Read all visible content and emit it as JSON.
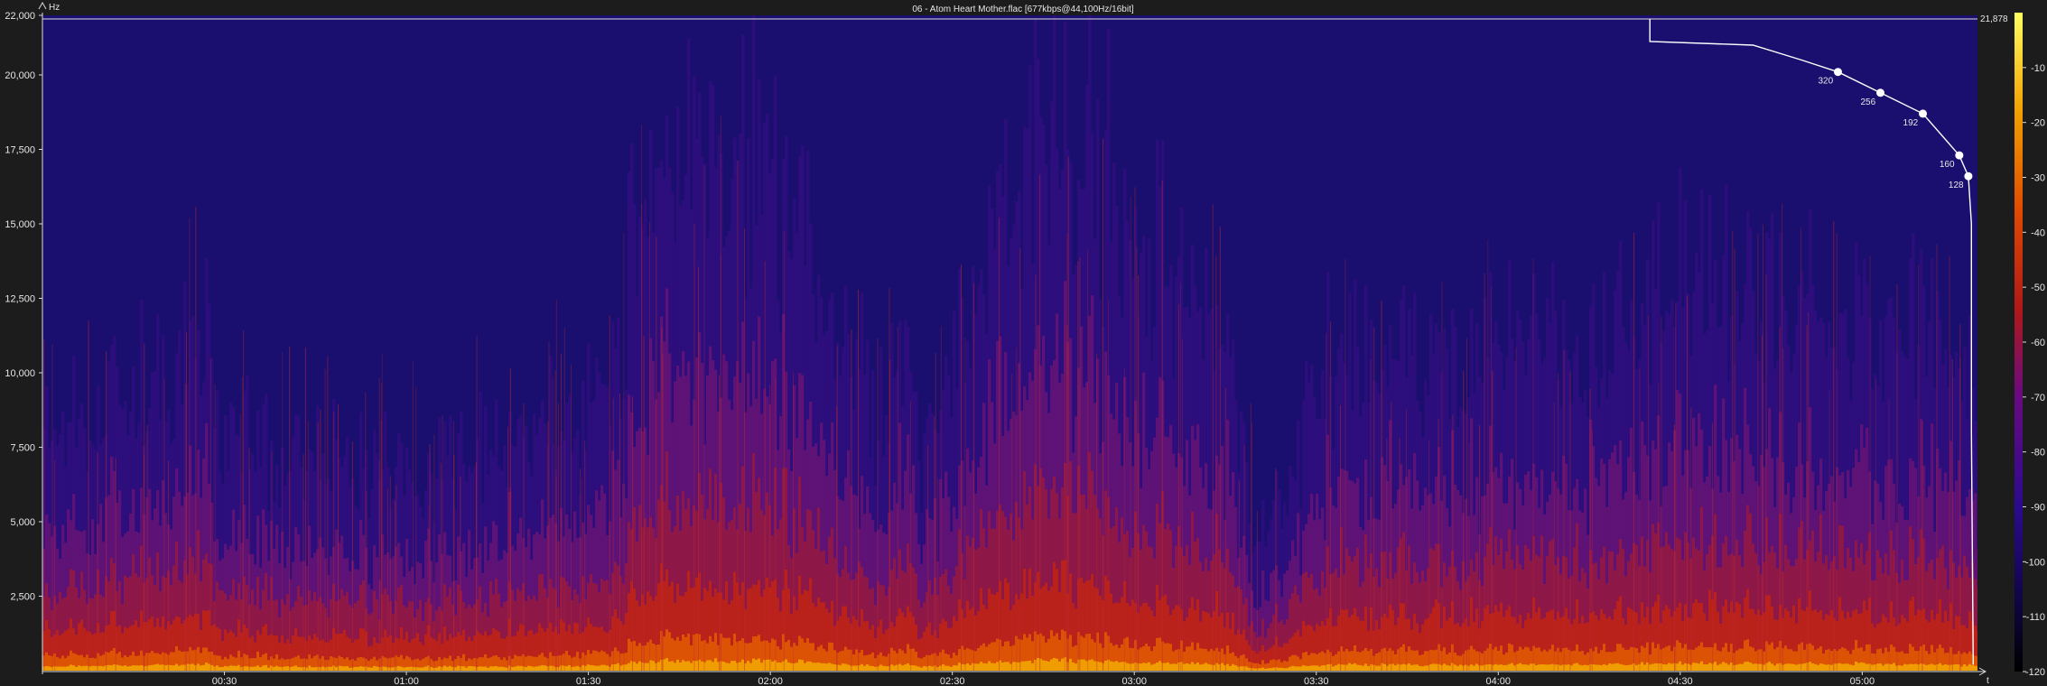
{
  "window": {
    "title": "06 - Atom Heart Mother.flac [677kbps@44,100Hz/16bit]"
  },
  "chart_data": {
    "type": "heatmap",
    "title": "06 - Atom Heart Mother.flac [677kbps@44,100Hz/16bit]",
    "ylabel": "Hz",
    "xlabel": "t",
    "x_range_seconds": [
      0,
      319
    ],
    "ylim": [
      0,
      22000
    ],
    "y_ticks": [
      2500,
      5000,
      7500,
      10000,
      12500,
      15000,
      17500,
      20000,
      22000
    ],
    "y_tick_labels": [
      "2,500",
      "5,000",
      "7,500",
      "10,000",
      "12,500",
      "15,000",
      "17,500",
      "20,000",
      "22,000"
    ],
    "x_ticks": [
      30,
      60,
      90,
      120,
      150,
      180,
      210,
      240,
      270,
      300
    ],
    "x_tick_labels": [
      "00:30",
      "01:00",
      "01:30",
      "02:00",
      "02:30",
      "03:00",
      "03:30",
      "04:00",
      "04:30",
      "05:00"
    ],
    "colorbar": {
      "range_db": [
        -120,
        0
      ],
      "ticks": [
        -10,
        -20,
        -30,
        -40,
        -50,
        -60,
        -70,
        -80,
        -90,
        -100,
        -110,
        -120
      ],
      "tick_labels": [
        "-10",
        "-20",
        "-30",
        "-40",
        "-50",
        "-60",
        "-70",
        "-80",
        "-90",
        "-100",
        "-110",
        "-120"
      ],
      "colors": [
        "#000000",
        "#1a0a6a",
        "#3a0aa0",
        "#7a0a78",
        "#b01010",
        "#e03a00",
        "#f07a00",
        "#f6c800",
        "#ffffa0"
      ]
    },
    "cutoff_label": "21,878",
    "cutoff_hz": 21878,
    "bitrate_markers": [
      {
        "label": "320",
        "hz": 20100
      },
      {
        "label": "256",
        "hz": 19400
      },
      {
        "label": "192",
        "hz": 18700
      },
      {
        "label": "160",
        "hz": 17300
      },
      {
        "label": "128",
        "hz": 16600
      }
    ],
    "energy_profile_seconds": [
      [
        0,
        0.55
      ],
      [
        10,
        0.6
      ],
      [
        20,
        0.62
      ],
      [
        25,
        0.72
      ],
      [
        30,
        0.55
      ],
      [
        45,
        0.5
      ],
      [
        60,
        0.48
      ],
      [
        75,
        0.52
      ],
      [
        82,
        0.58
      ],
      [
        88,
        0.55
      ],
      [
        95,
        0.65
      ],
      [
        98,
        0.85
      ],
      [
        105,
        0.9
      ],
      [
        115,
        0.88
      ],
      [
        125,
        0.82
      ],
      [
        130,
        0.7
      ],
      [
        138,
        0.55
      ],
      [
        142,
        0.7
      ],
      [
        145,
        0.5
      ],
      [
        150,
        0.62
      ],
      [
        158,
        0.85
      ],
      [
        165,
        0.9
      ],
      [
        172,
        0.88
      ],
      [
        180,
        0.8
      ],
      [
        188,
        0.75
      ],
      [
        195,
        0.7
      ],
      [
        200,
        0.35
      ],
      [
        205,
        0.45
      ],
      [
        210,
        0.65
      ],
      [
        225,
        0.66
      ],
      [
        240,
        0.68
      ],
      [
        255,
        0.66
      ],
      [
        265,
        0.7
      ],
      [
        270,
        0.74
      ],
      [
        285,
        0.72
      ],
      [
        300,
        0.7
      ],
      [
        310,
        0.68
      ],
      [
        319,
        0.6
      ]
    ]
  }
}
